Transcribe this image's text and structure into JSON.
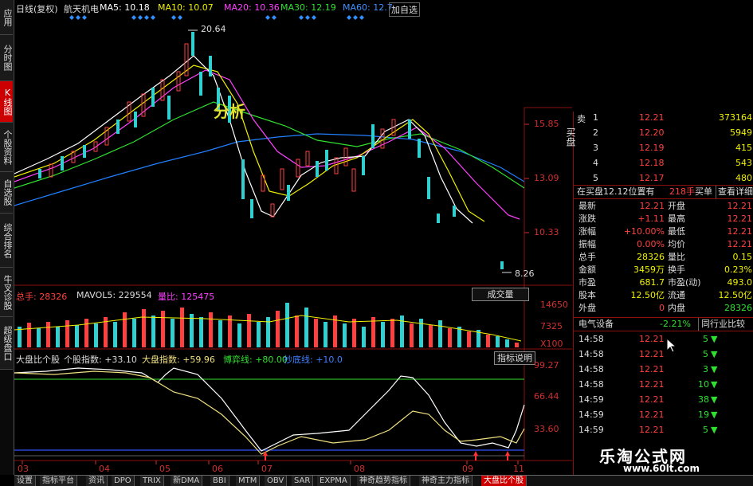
{
  "left_tabs": [
    "应用",
    "分时图",
    "K线图",
    "个股资料",
    "自选股",
    "综合排名",
    "牛叉诊股",
    "超级盘口"
  ],
  "header": {
    "period": "日线(复权)",
    "stock_name": "航天机电",
    "ma5": "MA5: 10.18",
    "ma10": "MA10: 10.07",
    "ma20": "MA20: 10.36",
    "ma30": "MA30: 12.19",
    "ma60": "MA60: 12.7",
    "add_watch": "加自选"
  },
  "price_axis": [
    "15.85",
    "13.09",
    "10.33"
  ],
  "annotations": {
    "high": "20.64",
    "low": "8.26",
    "overlay_text": "分析"
  },
  "volume_panel": {
    "total": "总手: 28326",
    "mavol": "MAVOL5: 229554",
    "ratio": "量比: 125475",
    "button": "成交量",
    "axis": [
      "14650",
      "7325",
      "X100"
    ]
  },
  "indicator_panel": {
    "label1": "大盘比个股",
    "label2": "个股指数: +33.10",
    "label3": "大盘指数: +59.96",
    "label4": "博弈线: +80.00",
    "label5": "抄底线: +10.0",
    "button": "指标说明",
    "axis": [
      "99.27",
      "66.44",
      "33.60"
    ]
  },
  "x_axis": [
    "03",
    "04",
    "05",
    "06",
    "07",
    "08",
    "09",
    "11"
  ],
  "order_book": [
    {
      "side": "卖",
      "level": "1",
      "price": "12.21",
      "vol": "373164"
    },
    {
      "side": "",
      "level": "2",
      "price": "12.20",
      "vol": "5949"
    },
    {
      "side": "",
      "level": "3",
      "price": "12.19",
      "vol": "415"
    },
    {
      "side": "",
      "level": "4",
      "price": "12.18",
      "vol": "543"
    },
    {
      "side": "",
      "level": "5",
      "price": "12.17",
      "vol": "480"
    }
  ],
  "buy_side_label": "买盘",
  "queue_line": {
    "text": "在买盘12.12位置有",
    "vol": "218手",
    "buy": "买单",
    "view": "查看详细"
  },
  "quote_rows": [
    {
      "l": "最新",
      "lv": "12.21",
      "r": "开盘",
      "rv": "12.21"
    },
    {
      "l": "涨跌",
      "lv": "+1.11",
      "r": "最高",
      "rv": "12.21"
    },
    {
      "l": "涨幅",
      "lv": "+10.00%",
      "r": "最低",
      "rv": "12.21"
    },
    {
      "l": "振幅",
      "lv": "0.00%",
      "r": "均价",
      "rv": "12.21"
    },
    {
      "l": "总手",
      "lv": "28326",
      "r": "量比",
      "rv": "0.15"
    },
    {
      "l": "金额",
      "lv": "3459万",
      "r": "换手",
      "rv": "0.23%"
    },
    {
      "l": "市盈",
      "lv": "681.7",
      "r": "市盈(动)",
      "rv": "493.0"
    },
    {
      "l": "股本",
      "lv": "12.50亿",
      "r": "流通",
      "rv": "12.50亿"
    },
    {
      "l": "外盘",
      "lv": "0",
      "r": "内盘",
      "rv": "28326"
    }
  ],
  "sector": {
    "name": "电气设备",
    "change": "-2.21%",
    "compare": "同行业比较"
  },
  "ticks": [
    {
      "t": "14:58",
      "p": "12.21",
      "v": "5"
    },
    {
      "t": "14:58",
      "p": "12.21",
      "v": "5"
    },
    {
      "t": "14:58",
      "p": "12.21",
      "v": "3"
    },
    {
      "t": "14:58",
      "p": "12.21",
      "v": "10"
    },
    {
      "t": "14:59",
      "p": "12.21",
      "v": "38"
    },
    {
      "t": "14:59",
      "p": "12.21",
      "v": "19"
    },
    {
      "t": "14:59",
      "p": "12.21",
      "v": "5"
    }
  ],
  "bottom_tabs": [
    "设置",
    "指标平台",
    "资讯",
    "DPO",
    "TRIX",
    "新DMA",
    "BBI",
    "MTM",
    "OBV",
    "SAR",
    "EXPMA",
    "神奇趋势指标",
    "神奇主力指标",
    "大盘比个股"
  ],
  "watermark": {
    "line1": "乐淘公式网",
    "line2": "www.60lt.com"
  },
  "colors": {
    "up": "#ff4040",
    "down": "#30e0e0",
    "ma5": "#ffffff",
    "ma10": "#f0f000",
    "ma20": "#ff40ff",
    "ma30": "#30e030",
    "ma60": "#2080ff"
  }
}
